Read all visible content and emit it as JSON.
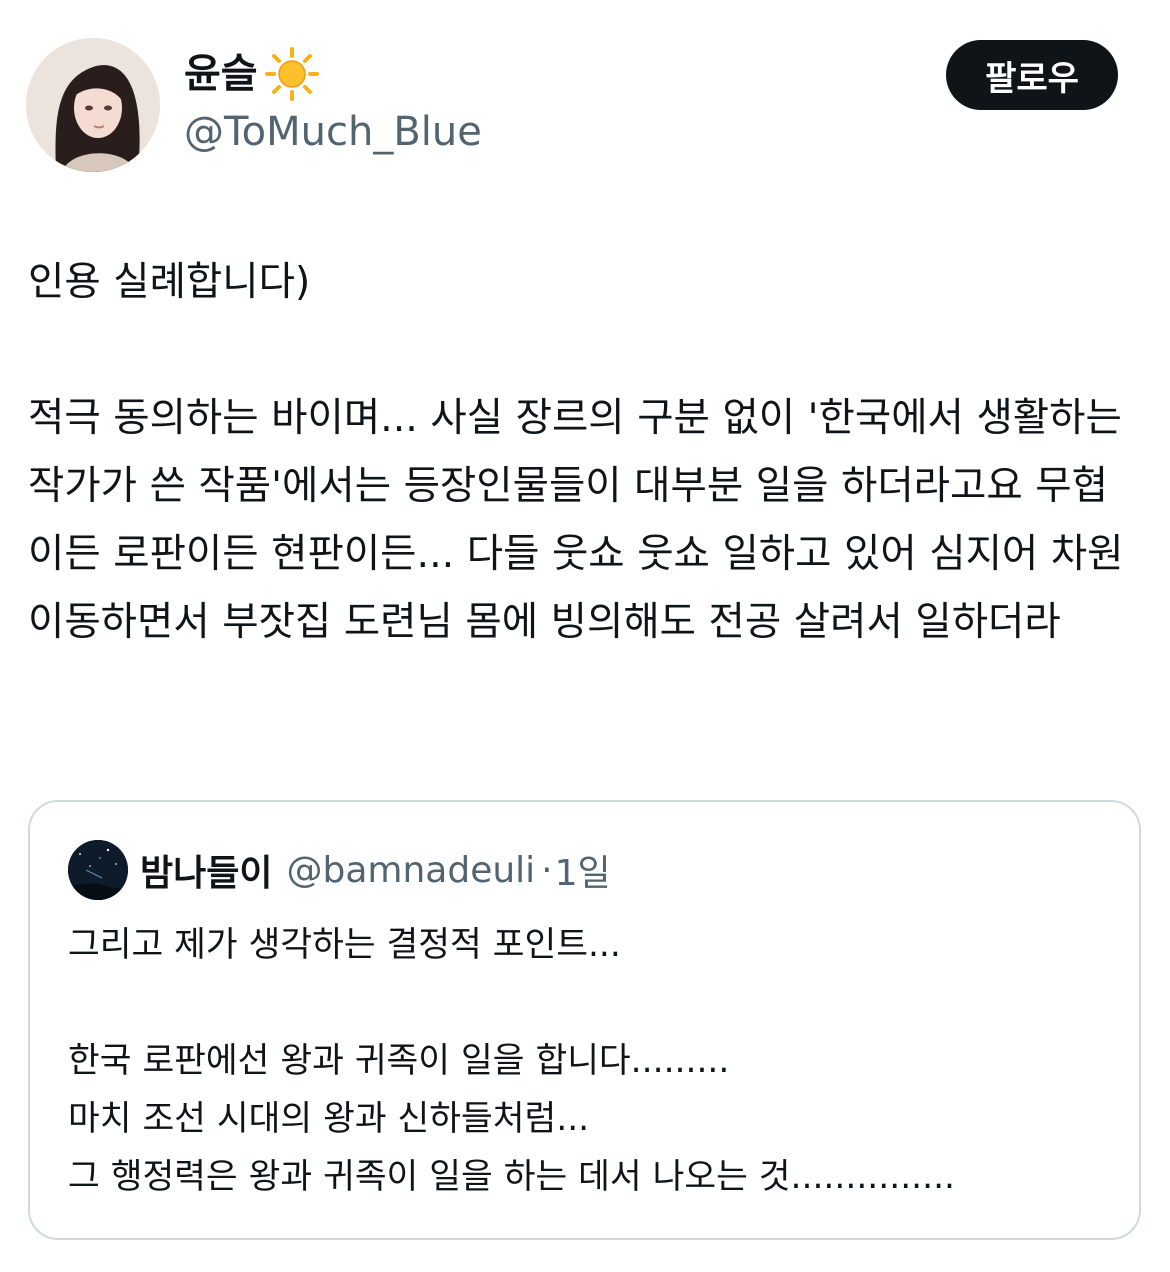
{
  "author": {
    "name": "윤슬",
    "handle": "@ToMuch_Blue",
    "name_icon": "sun-emoji",
    "avatar_icon": "illustrated-portrait-avatar"
  },
  "follow_button": {
    "label": "팔로우",
    "bg_color": "#0f1419",
    "text_color": "#ffffff"
  },
  "tweet": {
    "text": "인용 실례합니다)\n\n적극 동의하는 바이며... 사실 장르의 구분 없이 '한국에서 생활하는 작가가 쓴 작품'에서는 등장인물들이 대부분 일을 하더라고요 무협이든 로판이든 현판이든... 다들 웃쇼 웃쇼 일하고 있어 심지어 차원이동하면서 부잣집 도련님 몸에 빙의해도 전공 살려서 일하더라"
  },
  "quoted_tweet": {
    "name": "밤나들이",
    "handle": "@bamnadeuli",
    "separator": "·",
    "time": "1일",
    "avatar_icon": "night-sky-avatar",
    "text": "그리고 제가 생각하는 결정적 포인트...\n\n한국 로판에선 왕과 귀족이 일을 합니다.........\n마치 조선 시대의 왕과 신하들처럼...\n그 행정력은 왕과 귀족이 일을 하는 데서 나오는 것..............."
  },
  "colors": {
    "text": "#0f1419",
    "secondary": "#536471",
    "border": "#cfd9de",
    "sun": "#f7b21b"
  }
}
